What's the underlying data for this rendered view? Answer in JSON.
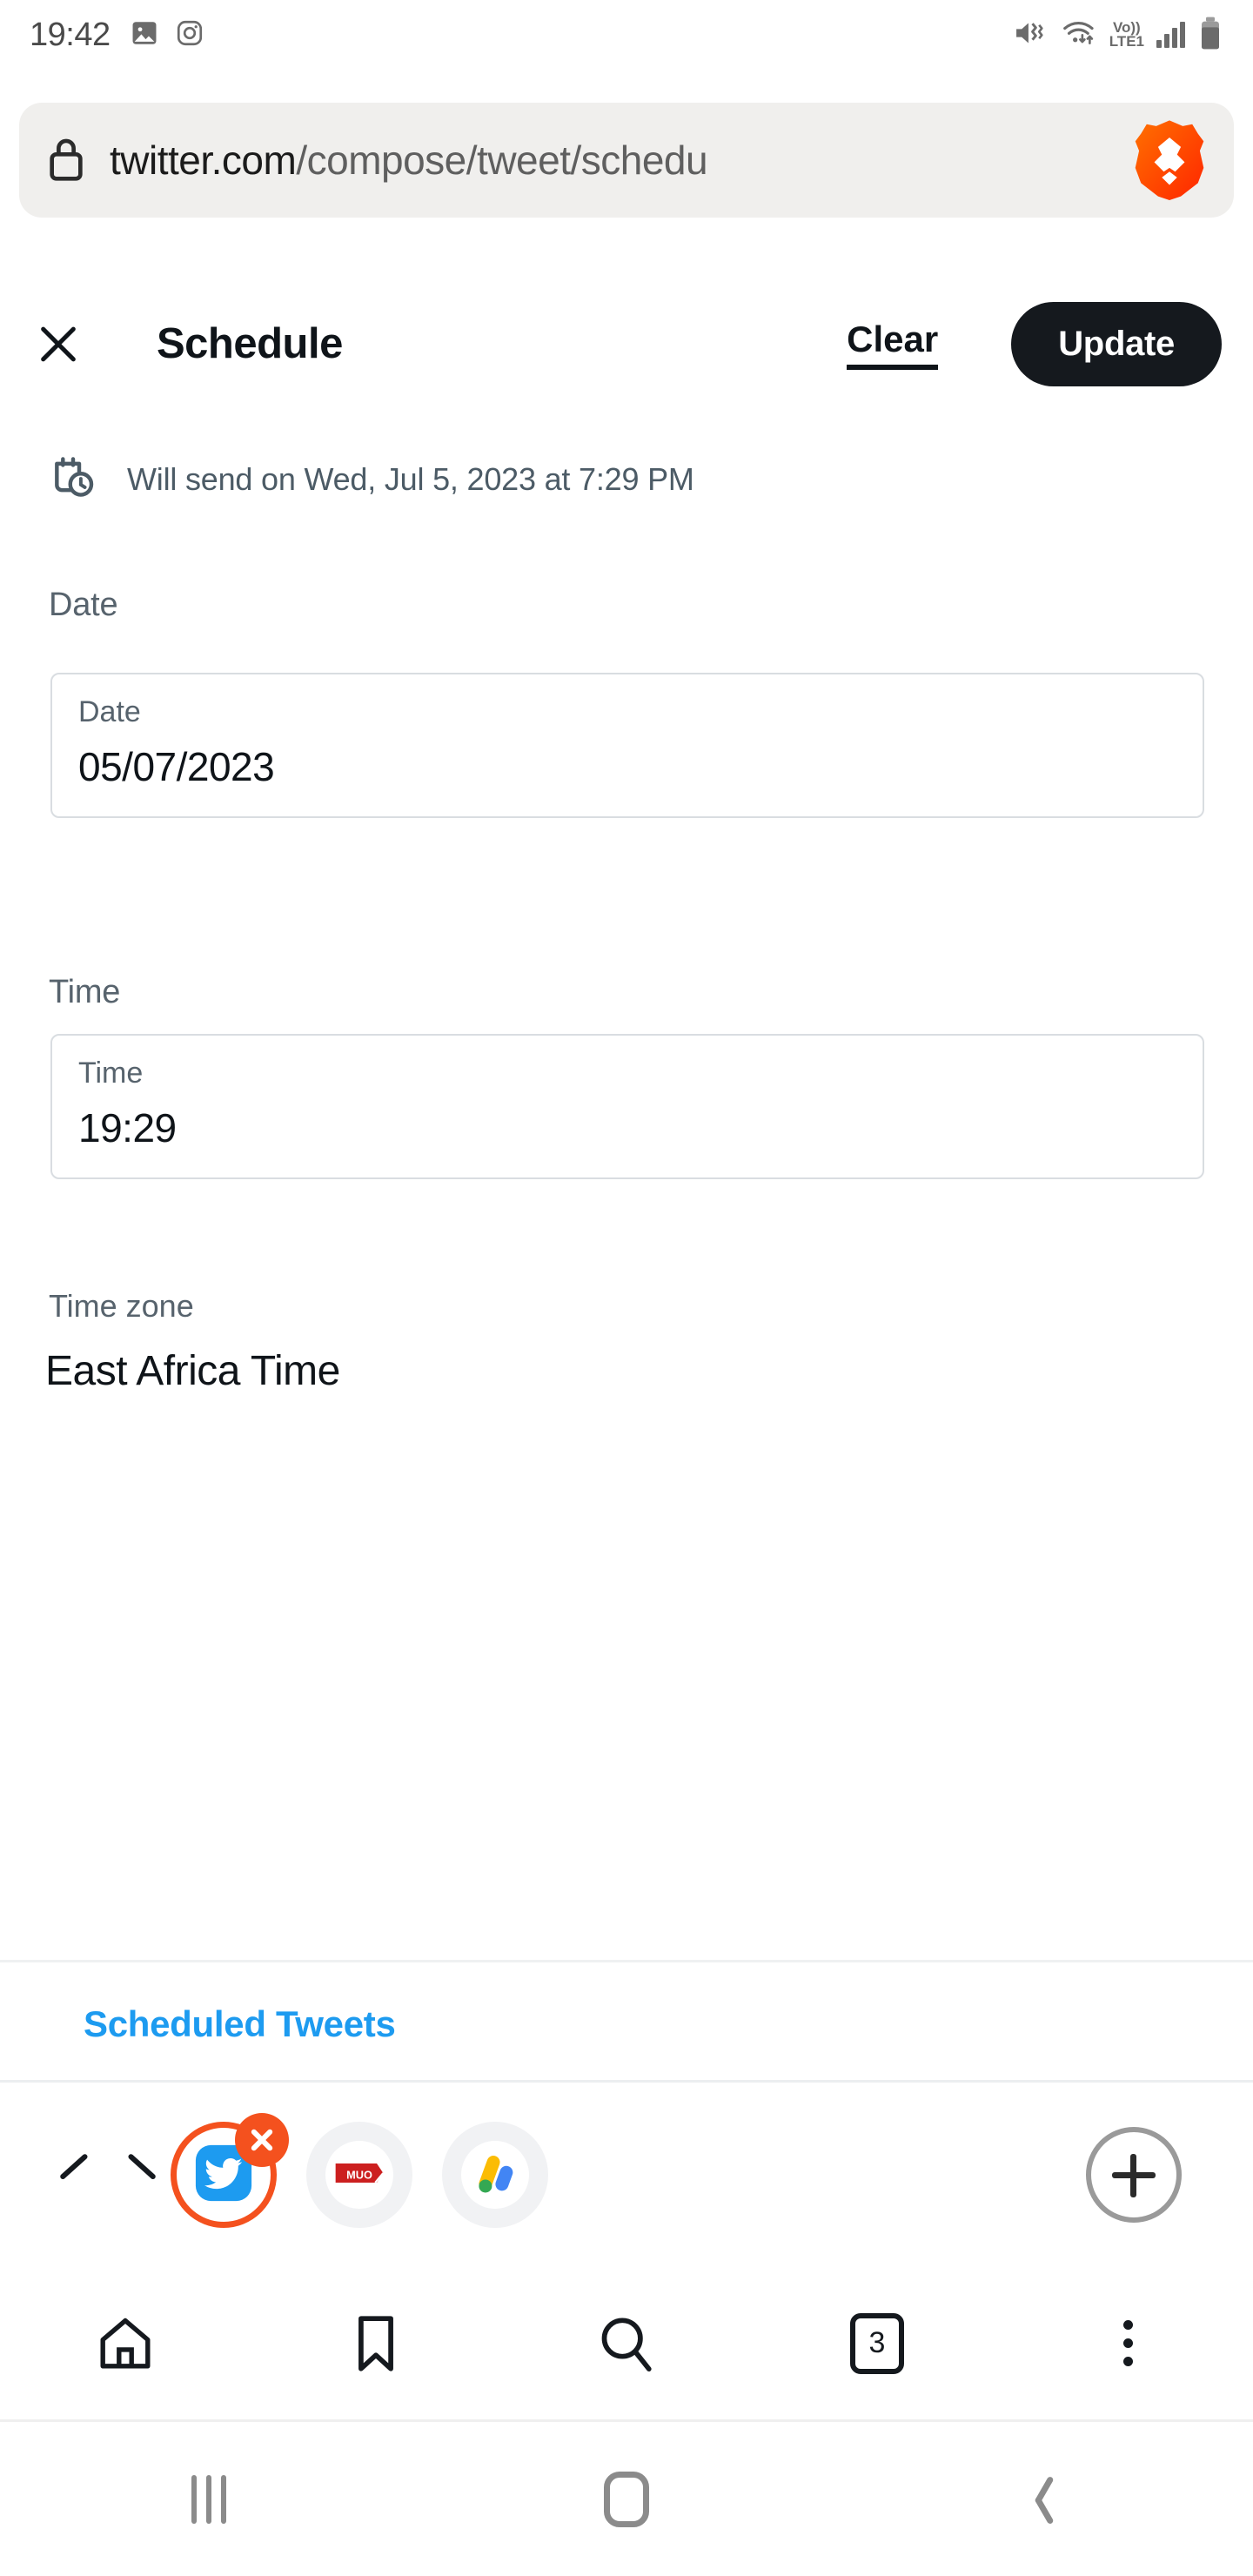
{
  "status_bar": {
    "time": "19:42",
    "left_icons": [
      "image-icon",
      "instagram-icon"
    ],
    "right_icons": [
      "mute-vibrate-icon",
      "wifi-icon",
      "volte-icon",
      "signal-bars-icon",
      "battery-icon"
    ],
    "network_label_top": "Vo))",
    "network_label_bottom": "LTE1"
  },
  "browser": {
    "url_secure_domain": "twitter.com",
    "url_path": "/compose/tweet/schedu",
    "lock_icon": "lock-icon",
    "brave_icon": "brave-lion-icon",
    "brave_color": "#ff3a00",
    "tabs": [
      {
        "name": "twitter-tab",
        "icon": "twitter-bird-icon",
        "active": true,
        "close_label": "x"
      },
      {
        "name": "muo-tab",
        "icon": "muo-logo-icon",
        "active": false,
        "label": "MUO"
      },
      {
        "name": "adsense-tab",
        "icon": "google-adsense-icon",
        "active": false
      }
    ],
    "collapse_icon": "chevron-up-icon",
    "new_tab_icon": "plus-icon",
    "bottom_nav": [
      {
        "name": "home-icon"
      },
      {
        "name": "bookmarks-icon"
      },
      {
        "name": "search-icon"
      },
      {
        "name": "tab-counter",
        "count": "3"
      },
      {
        "name": "more-menu-icon"
      }
    ]
  },
  "page": {
    "header": {
      "close_icon": "close-icon",
      "title": "Schedule",
      "clear_label": "Clear",
      "update_label": "Update",
      "update_bg": "#15191e"
    },
    "will_send": {
      "icon": "calendar-clock-icon",
      "text": "Will send on Wed, Jul 5, 2023 at 7:29 PM"
    },
    "date_field": {
      "section_label": "Date",
      "inner_label": "Date",
      "value": "05/07/2023"
    },
    "time_field": {
      "section_label": "Time",
      "inner_label": "Time",
      "value": "19:29"
    },
    "timezone": {
      "label": "Time zone",
      "value": "East Africa Time"
    },
    "scheduled_tweets_link": "Scheduled Tweets",
    "link_color": "#1d9bf0"
  },
  "system_nav": {
    "recents": "recents-icon",
    "home": "home-icon",
    "back": "back-icon"
  }
}
